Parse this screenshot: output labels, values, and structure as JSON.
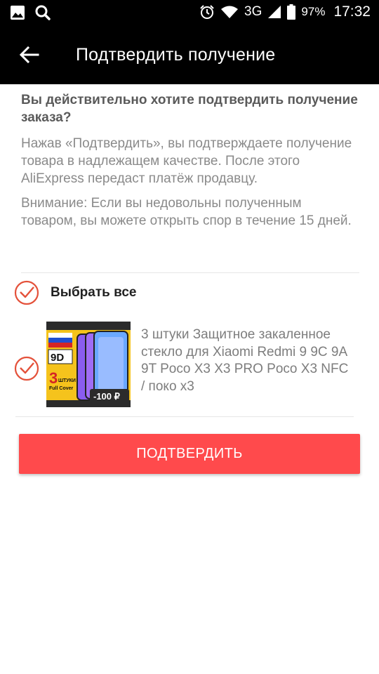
{
  "status_bar": {
    "network": "3G",
    "battery_percent": "97%",
    "time": "17:32",
    "icons": [
      "image-icon",
      "search-icon",
      "alarm-icon",
      "wifi-icon",
      "signal-icon",
      "battery-icon"
    ]
  },
  "header": {
    "title": "Подтвердить получение"
  },
  "content": {
    "question": "Вы действительно хотите подтвердить получение заказа?",
    "explanation": "Нажав «Подтвердить», вы подтверждаете получение товара в надлежащем качестве. После этого AliExpress передаст платёж продавцу.",
    "warning": "Внимание: Если вы недовольны полученным товаром, вы можете открыть спор в течение 15 дней."
  },
  "select_all": {
    "label": "Выбрать все",
    "checked": true
  },
  "items": [
    {
      "title": "3 штуки Защитное закаленное стекло для Xiaomi Redmi 9 9C 9A 9T Poco X3 X3 PRO Poco X3 NFC / поко x3",
      "checked": true,
      "thumbnail": {
        "badge_9d": "9D",
        "badge_count": "3",
        "badge_count_word": "ШТУКИ",
        "badge_full_cover": "Full Cover",
        "discount": "-100 ₽"
      }
    }
  ],
  "confirm_button": {
    "label": "ПОДТВЕРДИТЬ"
  },
  "colors": {
    "accent": "#ff4a4c",
    "check": "#e4513a",
    "bar": "#000000"
  }
}
